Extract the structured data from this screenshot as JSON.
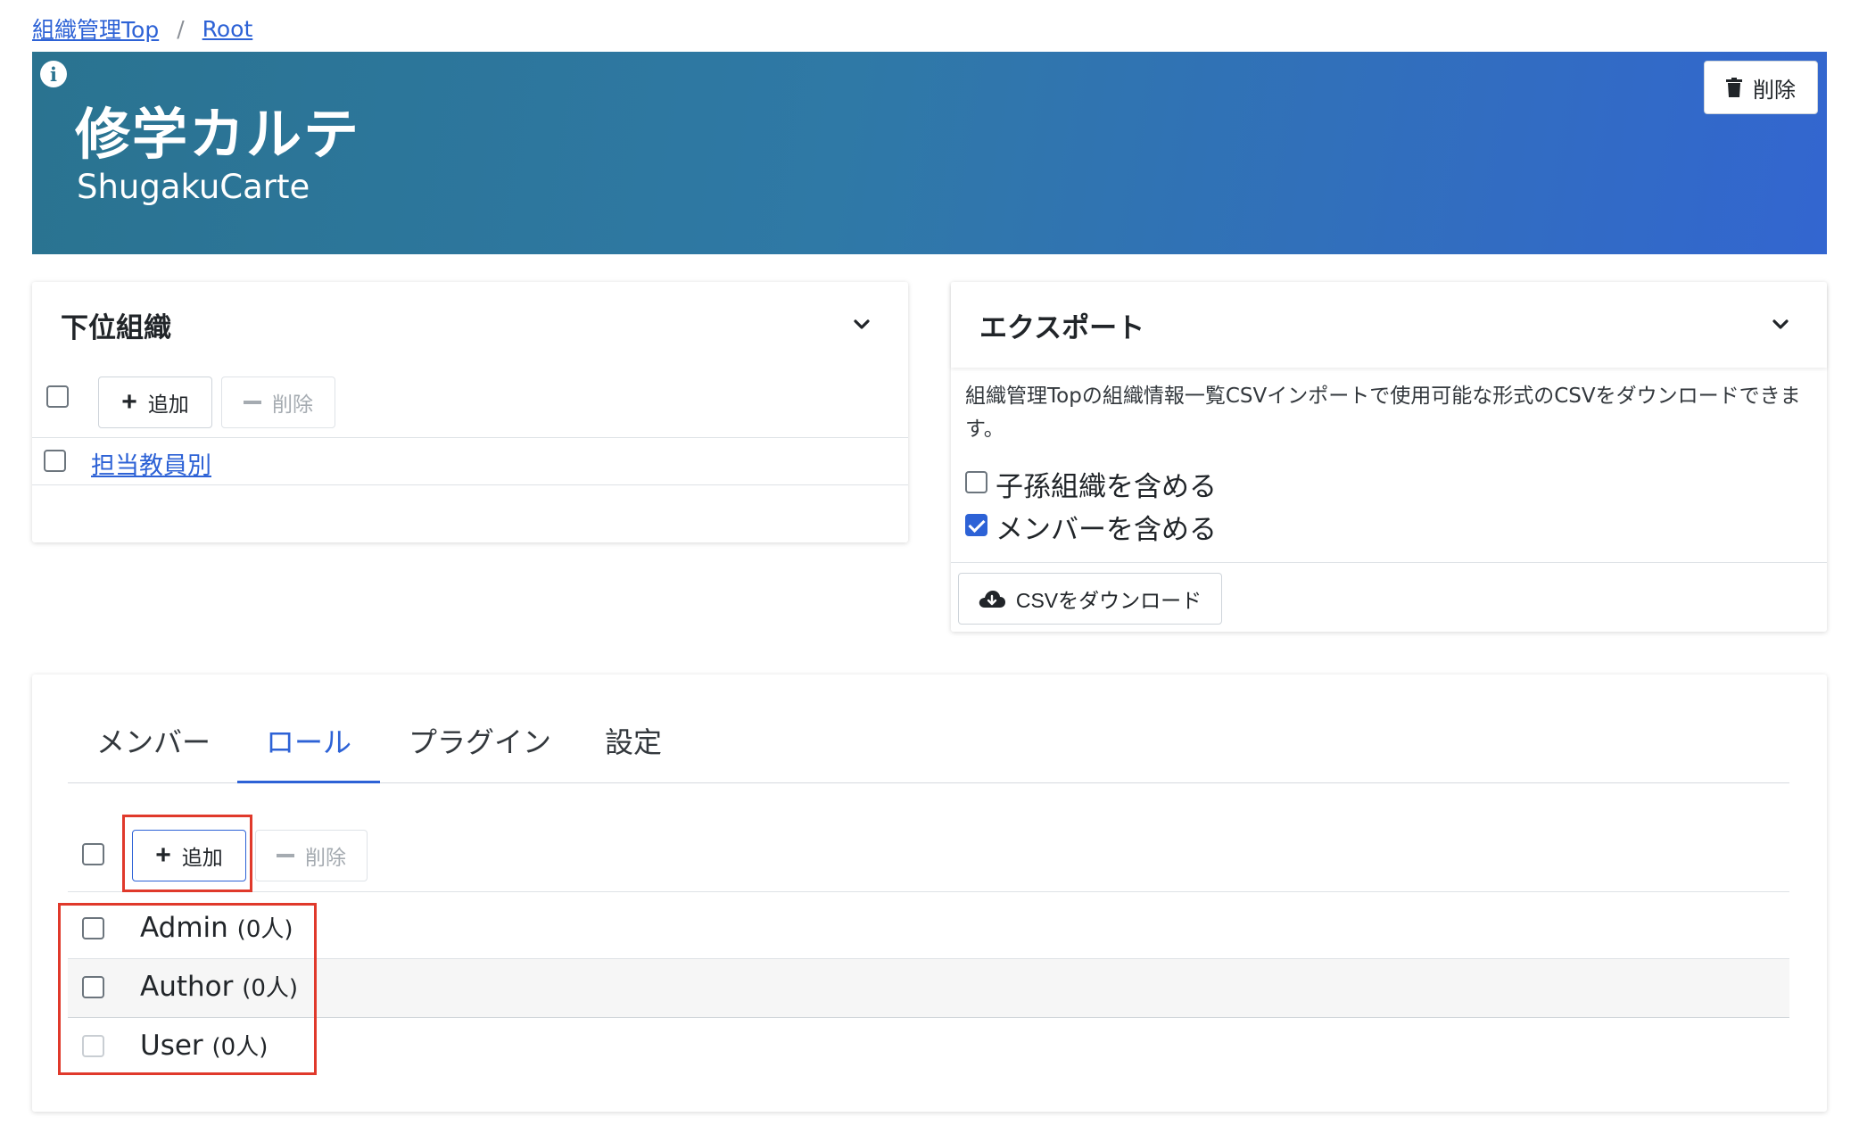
{
  "breadcrumb": {
    "items": [
      "組織管理Top",
      "Root"
    ],
    "separator": "/"
  },
  "header": {
    "title": "修学カルテ",
    "subtitle": "ShugakuCarte",
    "info_icon": "info-icon",
    "delete_label": "削除"
  },
  "suborg": {
    "title": "下位組織",
    "add_label": "追加",
    "delete_label": "削除",
    "items": [
      "担当教員別"
    ]
  },
  "export": {
    "title": "エクスポート",
    "description": "組織管理Topの組織情報一覧CSVインポートで使用可能な形式のCSVをダウンロードできます。",
    "options": [
      {
        "label": "子孫組織を含める",
        "checked": false
      },
      {
        "label": "メンバーを含める",
        "checked": true
      }
    ],
    "download_label": "CSVをダウンロード"
  },
  "tabs": {
    "items": [
      "メンバー",
      "ロール",
      "プラグイン",
      "設定"
    ],
    "active": "ロール"
  },
  "roles": {
    "add_label": "追加",
    "delete_label": "削除",
    "items": [
      {
        "name": "Admin",
        "count": "(0人)"
      },
      {
        "name": "Author",
        "count": "(0人)"
      },
      {
        "name": "User",
        "count": "(0人)"
      }
    ]
  },
  "colors": {
    "accent": "#2d62d6",
    "banner_start": "#2a7390",
    "banner_end": "#3366d0",
    "highlight": "#e0392b"
  }
}
